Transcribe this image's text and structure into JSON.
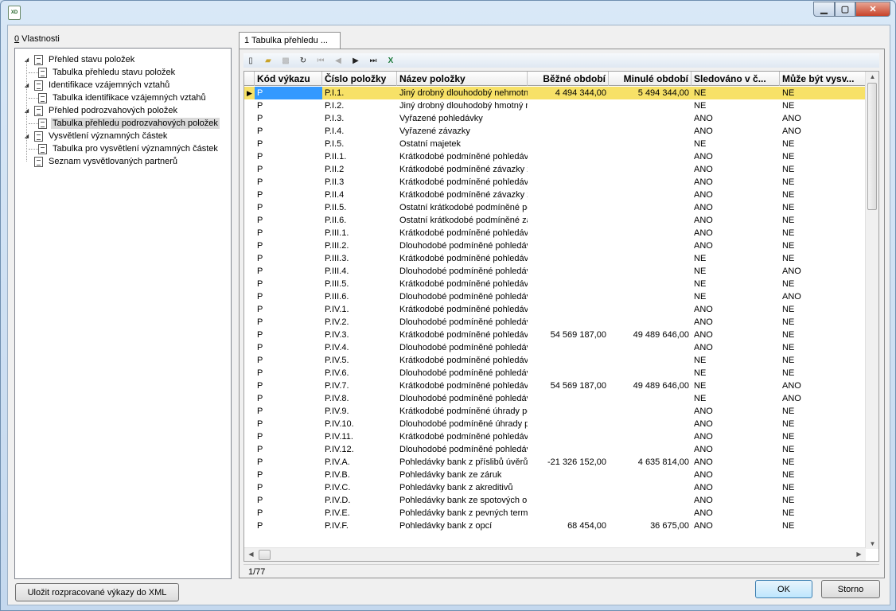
{
  "window": {
    "minimize_icon": "minimize-icon",
    "maximize_icon": "maximize-icon",
    "close_icon": "close-icon"
  },
  "left_panel": {
    "label_prefix": "0",
    "label_rest": " Vlastnosti"
  },
  "tree": [
    {
      "label": "Přehled stavu položek",
      "level": 0,
      "expanded": true
    },
    {
      "label": "Tabulka přehledu stavu položek",
      "level": 1
    },
    {
      "label": "Identifikace vzájemných vztahů",
      "level": 0,
      "expanded": true
    },
    {
      "label": "Tabulka identifikace vzájemných vztahů",
      "level": 1
    },
    {
      "label": "Přehled podrozvahových položek",
      "level": 0,
      "expanded": true
    },
    {
      "label": "Tabulka přehledu podrozvahových položek",
      "level": 1,
      "selected": true
    },
    {
      "label": "Vysvětlení významných částek",
      "level": 0,
      "expanded": true
    },
    {
      "label": "Tabulka pro vysvětlení významných částek",
      "level": 1
    },
    {
      "label": "Seznam vysvětlovaných partnerů",
      "level": 0
    }
  ],
  "tab": {
    "label": "1 Tabulka přehledu ..."
  },
  "toolbar": [
    "new-icon",
    "open-icon",
    "delete-icon",
    "refresh-icon",
    "first-icon",
    "prev-icon",
    "next-icon",
    "last-icon",
    "excel-icon"
  ],
  "grid": {
    "headers": [
      "Kód výkazu",
      "Číslo položky",
      "Název položky",
      "Běžné období",
      "Minulé období",
      "Sledováno v č...",
      "Může být vysv..."
    ],
    "rows": [
      [
        "P",
        "P.I.1.",
        "Jiný drobný dlouhodobý nehmotný majetek",
        "4 494 344,00",
        "5 494 344,00",
        "NE",
        "NE"
      ],
      [
        "P",
        "P.I.2.",
        "Jiný drobný dlouhodobý hmotný majetek",
        "",
        "",
        "NE",
        "NE"
      ],
      [
        "P",
        "P.I.3.",
        "Vyřazené pohledávky",
        "",
        "",
        "ANO",
        "ANO"
      ],
      [
        "P",
        "P.I.4.",
        "Vyřazené závazky",
        "",
        "",
        "ANO",
        "ANO"
      ],
      [
        "P",
        "P.I.5.",
        "Ostatní majetek",
        "",
        "",
        "NE",
        "NE"
      ],
      [
        "P",
        "P.II.1.",
        "Krátkodobé podmíněné pohledávky",
        "",
        "",
        "ANO",
        "NE"
      ],
      [
        "P",
        "P.II.2",
        "Krátkodobé podmíněné závazky z",
        "",
        "",
        "ANO",
        "NE"
      ],
      [
        "P",
        "P.II.3",
        "Krátkodobé podmíněné pohledávky",
        "",
        "",
        "ANO",
        "NE"
      ],
      [
        "P",
        "P.II.4",
        "Krátkodobé podmíněné závazky z",
        "",
        "",
        "ANO",
        "NE"
      ],
      [
        "P",
        "P.II.5.",
        "Ostatní krátkodobé podmíněné po",
        "",
        "",
        "ANO",
        "NE"
      ],
      [
        "P",
        "P.II.6.",
        "Ostatní krátkodobé podmíněné zá",
        "",
        "",
        "ANO",
        "NE"
      ],
      [
        "P",
        "P.III.1.",
        "Krátkodobé podmíněné pohledávky",
        "",
        "",
        "ANO",
        "NE"
      ],
      [
        "P",
        "P.III.2.",
        "Dlouhodobé podmíněné pohledávky",
        "",
        "",
        "ANO",
        "NE"
      ],
      [
        "P",
        "P.III.3.",
        "Krátkodobé podmíněné pohledávky",
        "",
        "",
        "NE",
        "NE"
      ],
      [
        "P",
        "P.III.4.",
        "Dlouhodobé podmíněné pohledávky",
        "",
        "",
        "NE",
        "ANO"
      ],
      [
        "P",
        "P.III.5.",
        "Krátkodobé podmíněné pohledávky",
        "",
        "",
        "NE",
        "NE"
      ],
      [
        "P",
        "P.III.6.",
        "Dlouhodobé podmíněné pohledávky",
        "",
        "",
        "NE",
        "ANO"
      ],
      [
        "P",
        "P.IV.1.",
        "Krátkodobé podmíněné pohledávky",
        "",
        "",
        "ANO",
        "NE"
      ],
      [
        "P",
        "P.IV.2.",
        "Dlouhodobé podmíněné pohledávky",
        "",
        "",
        "ANO",
        "NE"
      ],
      [
        "P",
        "P.IV.3.",
        "Krátkodobé podmíněné pohledávky",
        "54 569 187,00",
        "49 489 646,00",
        "ANO",
        "NE"
      ],
      [
        "P",
        "P.IV.4.",
        "Dlouhodobé podmíněné pohledávky",
        "",
        "",
        "ANO",
        "NE"
      ],
      [
        "P",
        "P.IV.5.",
        "Krátkodobé podmíněné pohledávky",
        "",
        "",
        "NE",
        "NE"
      ],
      [
        "P",
        "P.IV.6.",
        "Dlouhodobé podmíněné pohledávky",
        "",
        "",
        "NE",
        "NE"
      ],
      [
        "P",
        "P.IV.7.",
        "Krátkodobé podmíněné pohledávky",
        "54 569 187,00",
        "49 489 646,00",
        "NE",
        "ANO"
      ],
      [
        "P",
        "P.IV.8.",
        "Dlouhodobé podmíněné pohledávky",
        "",
        "",
        "NE",
        "ANO"
      ],
      [
        "P",
        "P.IV.9.",
        "Krátkodobé podmíněné úhrady po",
        "",
        "",
        "ANO",
        "NE"
      ],
      [
        "P",
        "P.IV.10.",
        "Dlouhodobé podmíněné úhrady po",
        "",
        "",
        "ANO",
        "NE"
      ],
      [
        "P",
        "P.IV.11.",
        "Krátkodobé podmíněné pohledávky",
        "",
        "",
        "ANO",
        "NE"
      ],
      [
        "P",
        "P.IV.12.",
        "Dlouhodobé podmíněné pohledávky",
        "",
        "",
        "ANO",
        "NE"
      ],
      [
        "P",
        "P.IV.A.",
        "Pohledávky bank z příslibů úvěrů a",
        "-21 326 152,00",
        "4 635 814,00",
        "ANO",
        "NE"
      ],
      [
        "P",
        "P.IV.B.",
        "Pohledávky bank ze záruk",
        "",
        "",
        "ANO",
        "NE"
      ],
      [
        "P",
        "P.IV.C.",
        "Pohledávky bank z akreditivů",
        "",
        "",
        "ANO",
        "NE"
      ],
      [
        "P",
        "P.IV.D.",
        "Pohledávky bank ze spotových operací",
        "",
        "",
        "ANO",
        "NE"
      ],
      [
        "P",
        "P.IV.E.",
        "Pohledávky bank z pevných termínových",
        "",
        "",
        "ANO",
        "NE"
      ],
      [
        "P",
        "P.IV.F.",
        "Pohledávky bank z opcí",
        "68 454,00",
        "36 675,00",
        "ANO",
        "NE"
      ]
    ],
    "selected_row": 0
  },
  "status": {
    "record": "1/77"
  },
  "buttons": {
    "save_xml": "Uložit rozpracované výkazy do XML",
    "ok": "OK",
    "cancel": "Storno"
  }
}
